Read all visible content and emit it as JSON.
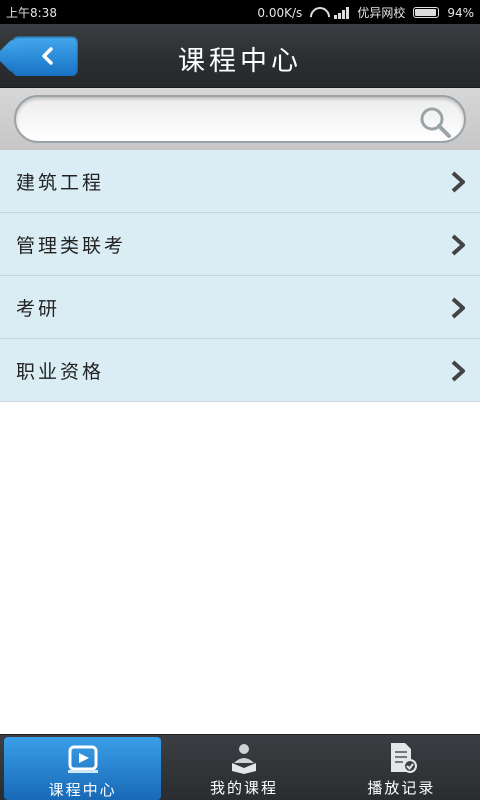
{
  "status_bar": {
    "time": "上午8:38",
    "network_speed": "0.00K/s",
    "carrier": "优异网校",
    "battery": "94%"
  },
  "header": {
    "title": "课程中心",
    "back_icon": "chevron-left-icon"
  },
  "search": {
    "placeholder": "",
    "icon": "search-icon"
  },
  "categories": [
    {
      "label": "建筑工程"
    },
    {
      "label": "管理类联考"
    },
    {
      "label": "考研"
    },
    {
      "label": "职业资格"
    }
  ],
  "tabs": [
    {
      "label": "课程中心",
      "icon": "play-icon",
      "active": true
    },
    {
      "label": "我的课程",
      "icon": "reader-icon",
      "active": false
    },
    {
      "label": "播放记录",
      "icon": "history-document-icon",
      "active": false
    }
  ],
  "colors": {
    "accent": "#1f7fd0",
    "list_bg": "#daedf5"
  }
}
